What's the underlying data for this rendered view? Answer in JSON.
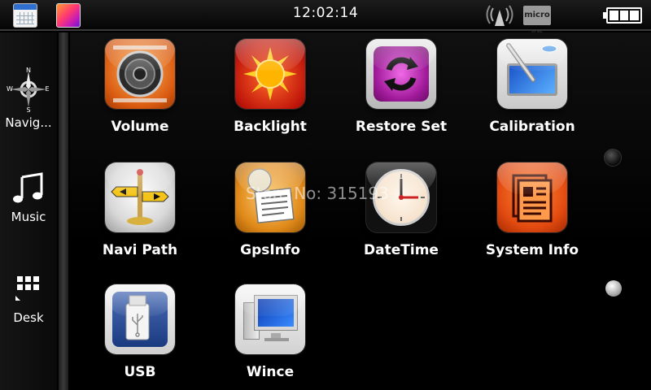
{
  "status_bar": {
    "time": "12:02:14",
    "sd_label": "micro SD",
    "icons": [
      "calendar-icon",
      "color-palette-icon",
      "signal-icon",
      "sd-card-icon",
      "battery-icon"
    ]
  },
  "sidebar": {
    "items": [
      {
        "label": "Navig...",
        "icon": "compass-icon",
        "compass": {
          "n": "N",
          "e": "E",
          "s": "S",
          "w": "W"
        }
      },
      {
        "label": "Music",
        "icon": "music-note-icon"
      },
      {
        "label": "Desk",
        "icon": "grid-icon"
      }
    ]
  },
  "apps": [
    {
      "label": "Volume",
      "icon": "speaker-icon"
    },
    {
      "label": "Backlight",
      "icon": "sun-icon"
    },
    {
      "label": "Restore Set",
      "icon": "restore-arrows-icon"
    },
    {
      "label": "Calibration",
      "icon": "touch-pen-icon"
    },
    {
      "label": "Navi Path",
      "icon": "signpost-icon"
    },
    {
      "label": "GpsInfo",
      "icon": "gps-document-icon"
    },
    {
      "label": "DateTime",
      "icon": "clock-icon"
    },
    {
      "label": "System Info",
      "icon": "document-icon"
    },
    {
      "label": "USB",
      "icon": "usb-icon"
    },
    {
      "label": "Wince",
      "icon": "computer-icon"
    }
  ],
  "watermark": "Store No: 315193",
  "colors": {
    "background": "#000000",
    "text": "#ffffff"
  }
}
